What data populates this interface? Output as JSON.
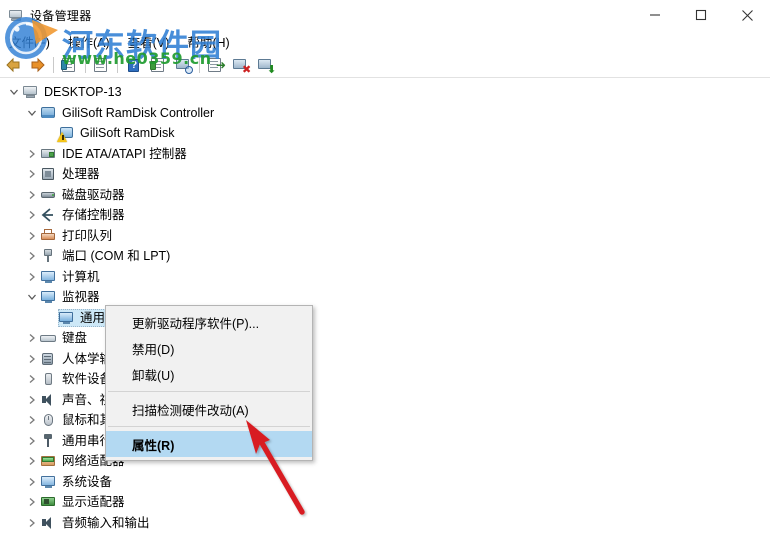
{
  "window": {
    "title": "设备管理器",
    "icon": "device-manager-icon",
    "controls": {
      "minimize": "minimize",
      "maximize": "maximize",
      "close": "close"
    }
  },
  "menubar": {
    "items": [
      {
        "label": "文件(F)"
      },
      {
        "label": "操作(A)"
      },
      {
        "label": "查看(V)"
      },
      {
        "label": "帮助(H)"
      }
    ]
  },
  "toolbar": {
    "buttons": [
      {
        "name": "back-button",
        "icon": "left-arrow-icon"
      },
      {
        "name": "forward-button",
        "icon": "right-arrow-icon"
      },
      {
        "name": "show-hide-console-tree-button",
        "icon": "console-tree-icon"
      },
      {
        "name": "properties-button",
        "icon": "properties-icon"
      },
      {
        "name": "help-button",
        "icon": "help-icon"
      },
      {
        "name": "update-driver-button",
        "icon": "update-driver-icon"
      },
      {
        "name": "scan-hardware-changes-button",
        "icon": "scan-hardware-icon"
      },
      {
        "name": "add-legacy-hardware-button",
        "icon": "add-hardware-icon"
      },
      {
        "name": "disable-device-button",
        "icon": "disable-device-icon"
      },
      {
        "name": "uninstall-device-button",
        "icon": "uninstall-device-icon"
      }
    ]
  },
  "tree": {
    "root": {
      "label": "DESKTOP-13",
      "icon": "computer-icon",
      "expanded": true
    },
    "items": [
      {
        "label": "GiliSoft RamDisk Controller",
        "icon": "controller-icon",
        "indent": 1,
        "state": "expanded",
        "warning": false
      },
      {
        "label": "GiliSoft RamDisk",
        "icon": "ramdisk-icon",
        "indent": 2,
        "state": "leaf",
        "warning": true
      },
      {
        "label": "IDE ATA/ATAPI 控制器",
        "icon": "ide-controller-icon",
        "indent": 1,
        "state": "collapsed",
        "warning": false
      },
      {
        "label": "处理器",
        "icon": "processor-icon",
        "indent": 1,
        "state": "collapsed",
        "warning": false
      },
      {
        "label": "磁盘驱动器",
        "icon": "disk-drive-icon",
        "indent": 1,
        "state": "collapsed",
        "warning": false
      },
      {
        "label": "存储控制器",
        "icon": "storage-controller-icon",
        "indent": 1,
        "state": "collapsed",
        "warning": false
      },
      {
        "label": "打印队列",
        "icon": "print-queue-icon",
        "indent": 1,
        "state": "collapsed",
        "warning": false
      },
      {
        "label": "端口 (COM 和 LPT)",
        "icon": "port-icon",
        "indent": 1,
        "state": "collapsed",
        "warning": false
      },
      {
        "label": "计算机",
        "icon": "computer-node-icon",
        "indent": 1,
        "state": "collapsed",
        "warning": false
      },
      {
        "label": "监视器",
        "icon": "monitor-icon",
        "indent": 1,
        "state": "expanded",
        "warning": false
      },
      {
        "label": "通用即插即用监视器",
        "icon": "monitor-device-icon",
        "indent": 2,
        "state": "leaf",
        "warning": false,
        "selected": true
      },
      {
        "label": "键盘",
        "icon": "keyboard-icon",
        "indent": 1,
        "state": "collapsed",
        "warning": false
      },
      {
        "label": "人体学输入设备",
        "icon": "hid-icon",
        "indent": 1,
        "state": "collapsed",
        "warning": false
      },
      {
        "label": "软件设备",
        "icon": "software-device-icon",
        "indent": 1,
        "state": "collapsed",
        "warning": false
      },
      {
        "label": "声音、视频和游戏控制器",
        "icon": "sound-icon",
        "indent": 1,
        "state": "collapsed",
        "warning": false
      },
      {
        "label": "鼠标和其他指针设备",
        "icon": "mouse-icon",
        "indent": 1,
        "state": "collapsed",
        "warning": false
      },
      {
        "label": "通用串行总线控制器",
        "icon": "usb-icon",
        "indent": 1,
        "state": "collapsed",
        "warning": false
      },
      {
        "label": "网络适配器",
        "icon": "network-adapter-icon",
        "indent": 1,
        "state": "collapsed",
        "warning": false
      },
      {
        "label": "系统设备",
        "icon": "system-device-icon",
        "indent": 1,
        "state": "collapsed",
        "warning": false
      },
      {
        "label": "显示适配器",
        "icon": "display-adapter-icon",
        "indent": 1,
        "state": "collapsed",
        "warning": false
      },
      {
        "label": "音频输入和输出",
        "icon": "audio-io-icon",
        "indent": 1,
        "state": "collapsed",
        "warning": false
      }
    ]
  },
  "context_menu": {
    "items": [
      {
        "label": "更新驱动程序软件(P)...",
        "highlighted": false,
        "separator_after": false
      },
      {
        "label": "禁用(D)",
        "highlighted": false,
        "separator_after": false
      },
      {
        "label": "卸载(U)",
        "highlighted": false,
        "separator_after": true
      },
      {
        "label": "扫描检测硬件改动(A)",
        "highlighted": false,
        "separator_after": true
      },
      {
        "label": "属性(R)",
        "highlighted": true,
        "separator_after": false
      }
    ],
    "highlight_color": "#b3d9f2"
  },
  "annotation": {
    "arrow": "red-arrow-icon",
    "color": "#d81f20"
  },
  "watermark": {
    "site_name": "河东软件园",
    "url": "www.he0359.cn",
    "name_color": "#2f7fd4",
    "url_color": "#1f9c2f"
  }
}
